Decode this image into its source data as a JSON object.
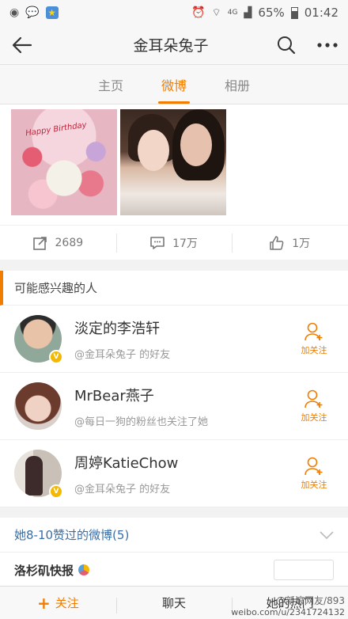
{
  "status_bar": {
    "signal_label": "4G",
    "battery": "65%",
    "time": "01:42"
  },
  "nav": {
    "title": "金耳朵兔子"
  },
  "tabs": [
    {
      "label": "主页",
      "active": false
    },
    {
      "label": "微博",
      "active": true
    },
    {
      "label": "相册",
      "active": false
    }
  ],
  "photos": {
    "cake_text": "Happy Birthday"
  },
  "actions": {
    "repost_count": "2689",
    "comment_count": "17万",
    "like_count": "1万"
  },
  "recommend": {
    "header": "可能感兴趣的人",
    "follow_label": "加关注",
    "items": [
      {
        "name": "淡定的李浩轩",
        "sub": "@金耳朵兔子 的好友",
        "verified": true
      },
      {
        "name": "MrBear燕子",
        "sub": "@每日一狗的粉丝也关注了她",
        "verified": false
      },
      {
        "name": "周婷KatieChow",
        "sub": "@金耳朵兔子 的好友",
        "verified": true
      }
    ]
  },
  "liked": {
    "label": "她8-10赞过的微博(5)"
  },
  "next_row": {
    "text": "洛杉矶快报"
  },
  "bottom_bar": {
    "follow": "关注",
    "chat": "聊天",
    "hot": "她的热门"
  },
  "watermark": {
    "line1": "@新浪网友/893",
    "line2": "weibo.com/u/2341724132"
  },
  "colors": {
    "accent": "#f07d00",
    "link": "#3a6ea5"
  }
}
